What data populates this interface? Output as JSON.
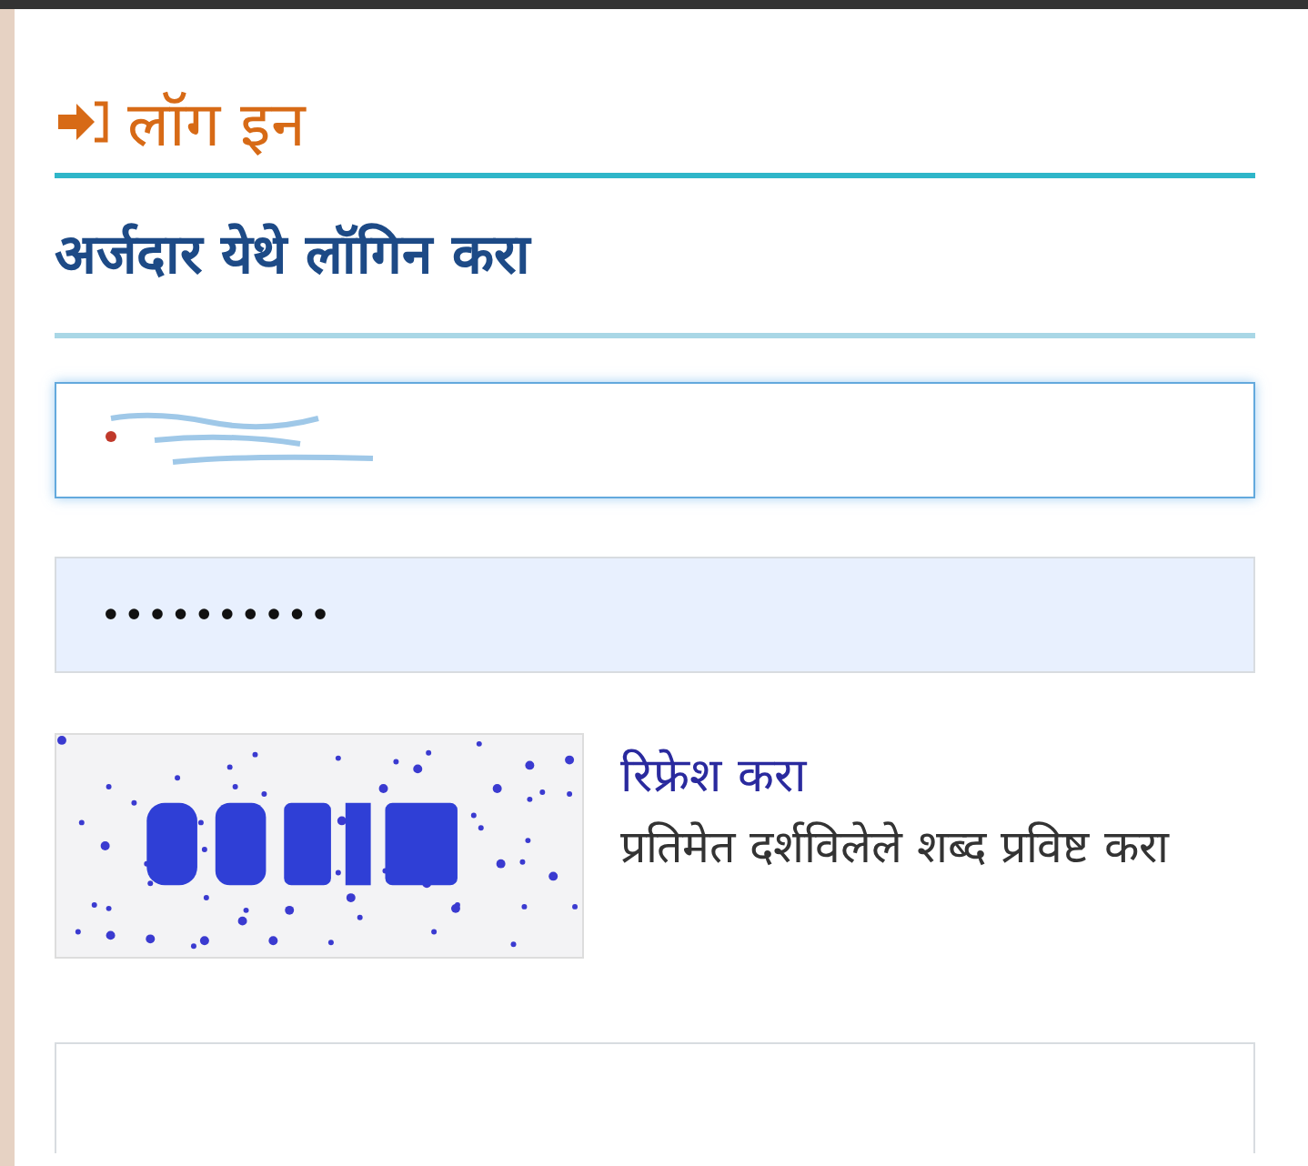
{
  "panel": {
    "title": "लॉग इन",
    "heading": "अर्जदार येथे लॉगिन करा"
  },
  "fields": [
    {
      "kind": "obscured",
      "focused": true,
      "filled": true
    },
    {
      "kind": "password",
      "focused": false,
      "filled": true,
      "value": "••••••••••"
    }
  ],
  "captcha": {
    "refresh_link": "रिफ्रेश करा",
    "hint": "प्रतिमेत दर्शविलेले शब्द प्रविष्ट करा"
  },
  "captcha_field": {
    "focused": false
  }
}
